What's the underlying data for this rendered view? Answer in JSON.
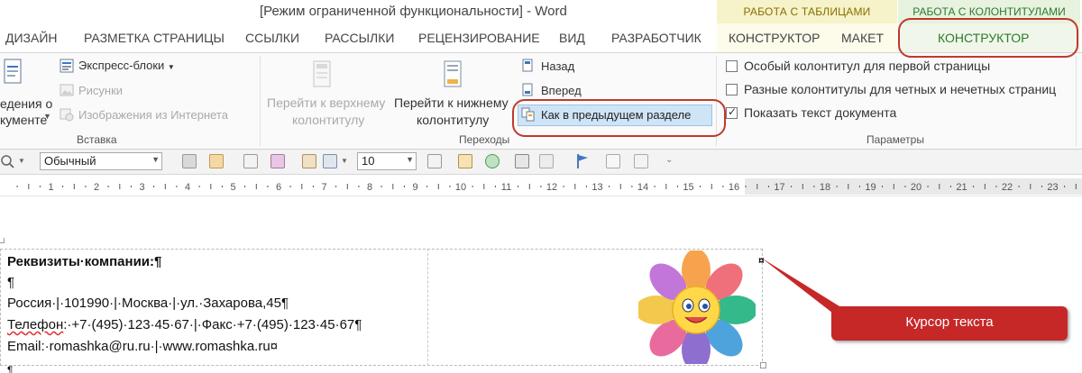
{
  "titlebar": {
    "title": "[Режим ограниченной функциональности] - Word",
    "context_tables": "РАБОТА С ТАБЛИЦАМИ",
    "context_headers": "РАБОТА С КОЛОНТИТУЛАМИ"
  },
  "tabs": [
    "ДИЗАЙН",
    "РАЗМЕТКА СТРАНИЦЫ",
    "ССЫЛКИ",
    "РАССЫЛКИ",
    "РЕЦЕНЗИРОВАНИЕ",
    "ВИД",
    "РАЗРАБОТЧИК",
    "КОНСТРУКТОР",
    "МАКЕТ",
    "КОНСТРУКТОР"
  ],
  "ribbon": {
    "insert": {
      "big_button_line1": "едения о",
      "big_button_line2": "кументе",
      "express_blocks": "Экспресс-блоки",
      "pictures": "Рисунки",
      "online_pictures": "Изображения из Интернета",
      "label": "Вставка"
    },
    "nav": {
      "goto_header_1": "Перейти к верхнему",
      "goto_header_2": "колонтитулу",
      "goto_footer_1": "Перейти к нижнему",
      "goto_footer_2": "колонтитулу",
      "back": "Назад",
      "forward": "Вперед",
      "link_previous": "Как в предыдущем разделе",
      "label": "Переходы"
    },
    "params": {
      "first_page": "Особый колонтитул для первой страницы",
      "odd_even": "Разные колонтитулы для четных и нечетных страниц",
      "show_text": "Показать текст документа",
      "label": "Параметры"
    }
  },
  "toolbar2": {
    "style": "Обычный",
    "size": "10"
  },
  "ruler": {
    "labels": [
      "1",
      "2",
      "3",
      "4",
      "5",
      "6",
      "7",
      "8",
      "9",
      "10",
      "11",
      "12",
      "13",
      "14",
      "15",
      "16",
      "17",
      "18",
      "19",
      "20",
      "21",
      "22",
      "23"
    ]
  },
  "document": {
    "heading": "Реквизиты·компании:¶",
    "empty_para": "¶",
    "address": "Россия·|·101990·|·Москва·|·ул.·Захарова,45¶",
    "phone_word": "Телефон",
    "phone_rest": ":·+7·(495)·123·45·67·|·Факс·+7·(495)·123·45·67¶",
    "email": "Email:·romashka@ru.ru·|·www.romashka.ru¤",
    "cell_end": "¤",
    "bottom_para": "¶"
  },
  "annotation": {
    "callout": "Курсор текста"
  },
  "colors": {
    "context_tables_bg": "#f6f2c9",
    "context_headers_bg": "#e7f2df",
    "annotation_red": "#c62828",
    "selected_button": "#cfe4f7"
  }
}
